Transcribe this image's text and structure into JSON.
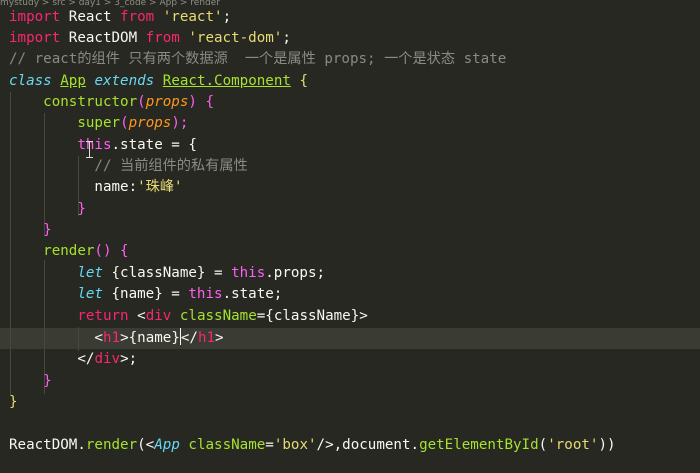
{
  "breadcrumb": "mystudy  >  src  >  day1  >  3_code  >  App  >  render",
  "code": {
    "l1": {
      "kw1": "import",
      "id": " React ",
      "kw2": "from",
      "sp": " ",
      "str": "'react'",
      "semi": ";"
    },
    "l2": {
      "kw1": "import",
      "id": " ReactDOM ",
      "kw2": "from",
      "sp": " ",
      "str": "'react-dom'",
      "semi": ";"
    },
    "l3": {
      "comment": "// react的组件 只有两个数据源  一个是属性 props; 一个是状态 state"
    },
    "l4": {
      "kw1": "class",
      "sp1": " ",
      "cls": "App",
      "sp2": " ",
      "kw2": "extends",
      "sp3": " ",
      "base1": "React",
      "dot": ".",
      "base2": "Component",
      "tail": " {"
    },
    "l5": {
      "indent": "    ",
      "fn": "constructor",
      "open": "(",
      "prm": "props",
      "close": ") {"
    },
    "l6": {
      "indent": "        ",
      "fn": "super",
      "open": "(",
      "prm": "props",
      "close": ");"
    },
    "l7": {
      "indent": "        ",
      "th": "this",
      "rest": ".state = {"
    },
    "l8": {
      "indent": "          ",
      "comment": "// 当前组件的私有属性"
    },
    "l9": {
      "indent": "          ",
      "key": "name:",
      "str": "'珠峰'"
    },
    "l10": {
      "indent": "        ",
      "brace": "}"
    },
    "l11": {
      "indent": "    ",
      "brace": "}"
    },
    "l12": {
      "indent": "    ",
      "fn": "render",
      "rest": "() {"
    },
    "l13": {
      "indent": "        ",
      "kw": "let",
      "mid": " {className} = ",
      "th": "this",
      "rest": ".props;"
    },
    "l14": {
      "indent": "        ",
      "kw": "let",
      "mid": " {name} = ",
      "th": "this",
      "rest": ".state;"
    },
    "l15": {
      "indent": "        ",
      "kw": "return",
      "sp": " ",
      "lt": "<",
      "tag": "div",
      "sp2": " ",
      "attr": "className",
      "rest": "={className}>"
    },
    "l16": {
      "indent": "          ",
      "lt1": "<",
      "tag1": "h1",
      "gt1": ">",
      "expr": "{name}",
      "lt2": "</",
      "tag2": "h1",
      "gt2": ">"
    },
    "l17": {
      "indent": "        ",
      "lt": "</",
      "tag": "div",
      "rest": ">;"
    },
    "l18": {
      "indent": "    ",
      "brace": "}"
    },
    "l19": {
      "brace": "}"
    },
    "l21": {
      "obj": "ReactDOM",
      "dot": ".",
      "fn": "render",
      "open": "(<",
      "cls": "App",
      "sp": " ",
      "attr": "className",
      "eq": "=",
      "str": "'box'",
      "close": "/>,",
      "doc": "document",
      "dot2": ".",
      "fn2": "getElementById",
      "open2": "(",
      "str2": "'root'",
      "close2": "))"
    }
  }
}
